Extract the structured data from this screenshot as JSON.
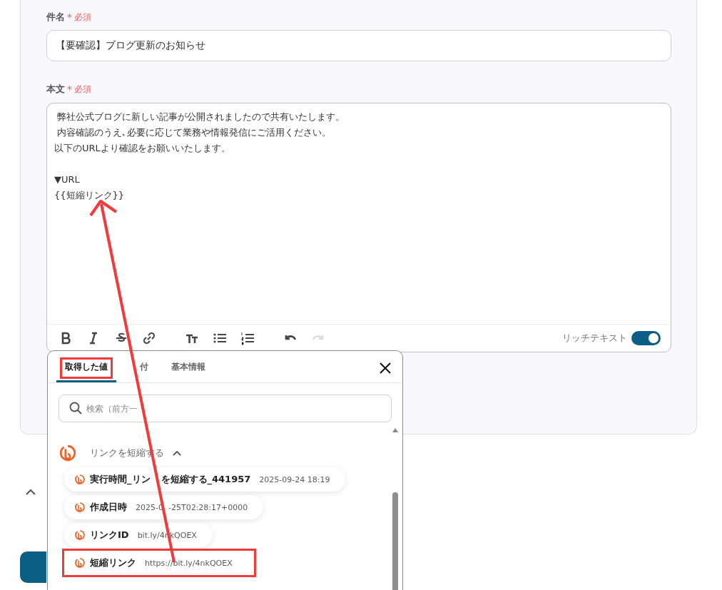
{
  "subject": {
    "label": "件名",
    "required_mark": "*",
    "required": "必須",
    "value": "【要確認】ブログ更新のお知らせ"
  },
  "body": {
    "label": "本文",
    "required_mark": "*",
    "required": "必須",
    "paragraphs": [
      [
        " 弊社公式ブログに新しい記事が公開されましたので共有いたします。",
        " 内容確認のうえ､必要に応じて業務や情報発信にご活用ください。",
        "以下のURLより確認をお願いいたします。"
      ],
      [
        "▼URL",
        "{{短縮リンク}}"
      ]
    ]
  },
  "toolbar": [
    {
      "kind": "bold",
      "disabled": false
    },
    {
      "kind": "italic",
      "disabled": false
    },
    {
      "kind": "strike",
      "disabled": false
    },
    {
      "kind": "link",
      "disabled": false
    },
    {
      "kind": "size",
      "disabled": false
    },
    {
      "kind": "bullets",
      "disabled": false
    },
    {
      "kind": "numbers",
      "disabled": false
    },
    {
      "kind": "undo",
      "disabled": false
    },
    {
      "kind": "redo",
      "disabled": true
    }
  ],
  "rich_text": {
    "label": "リッチテキスト",
    "on": true
  },
  "picker": {
    "tabs": [
      {
        "label": "取得した値",
        "selected": true,
        "highlighted": true
      },
      {
        "label": "付",
        "selected": false,
        "highlighted": false
      },
      {
        "label": "基本情報",
        "selected": false,
        "highlighted": false
      }
    ],
    "search": {
      "placeholder": "検索（前方一"
    },
    "group": {
      "title": "リンクを短縮する",
      "expanded": true,
      "items": [
        {
          "name": "実行時間_リン",
          "name_after": "を短縮する_441957",
          "value": "2025-09-24 18:19",
          "highlighted": false
        },
        {
          "name": "作成日時",
          "value": "2025-0",
          "value_after": "-25T02:28:17+0000",
          "highlighted": false
        },
        {
          "name": "リンクID",
          "value": "bit.ly/4nkQOEX",
          "highlighted": false
        },
        {
          "name": "短縮リンク",
          "value": "https://bit.ly/4nkQOEX",
          "highlighted": true
        }
      ]
    }
  }
}
